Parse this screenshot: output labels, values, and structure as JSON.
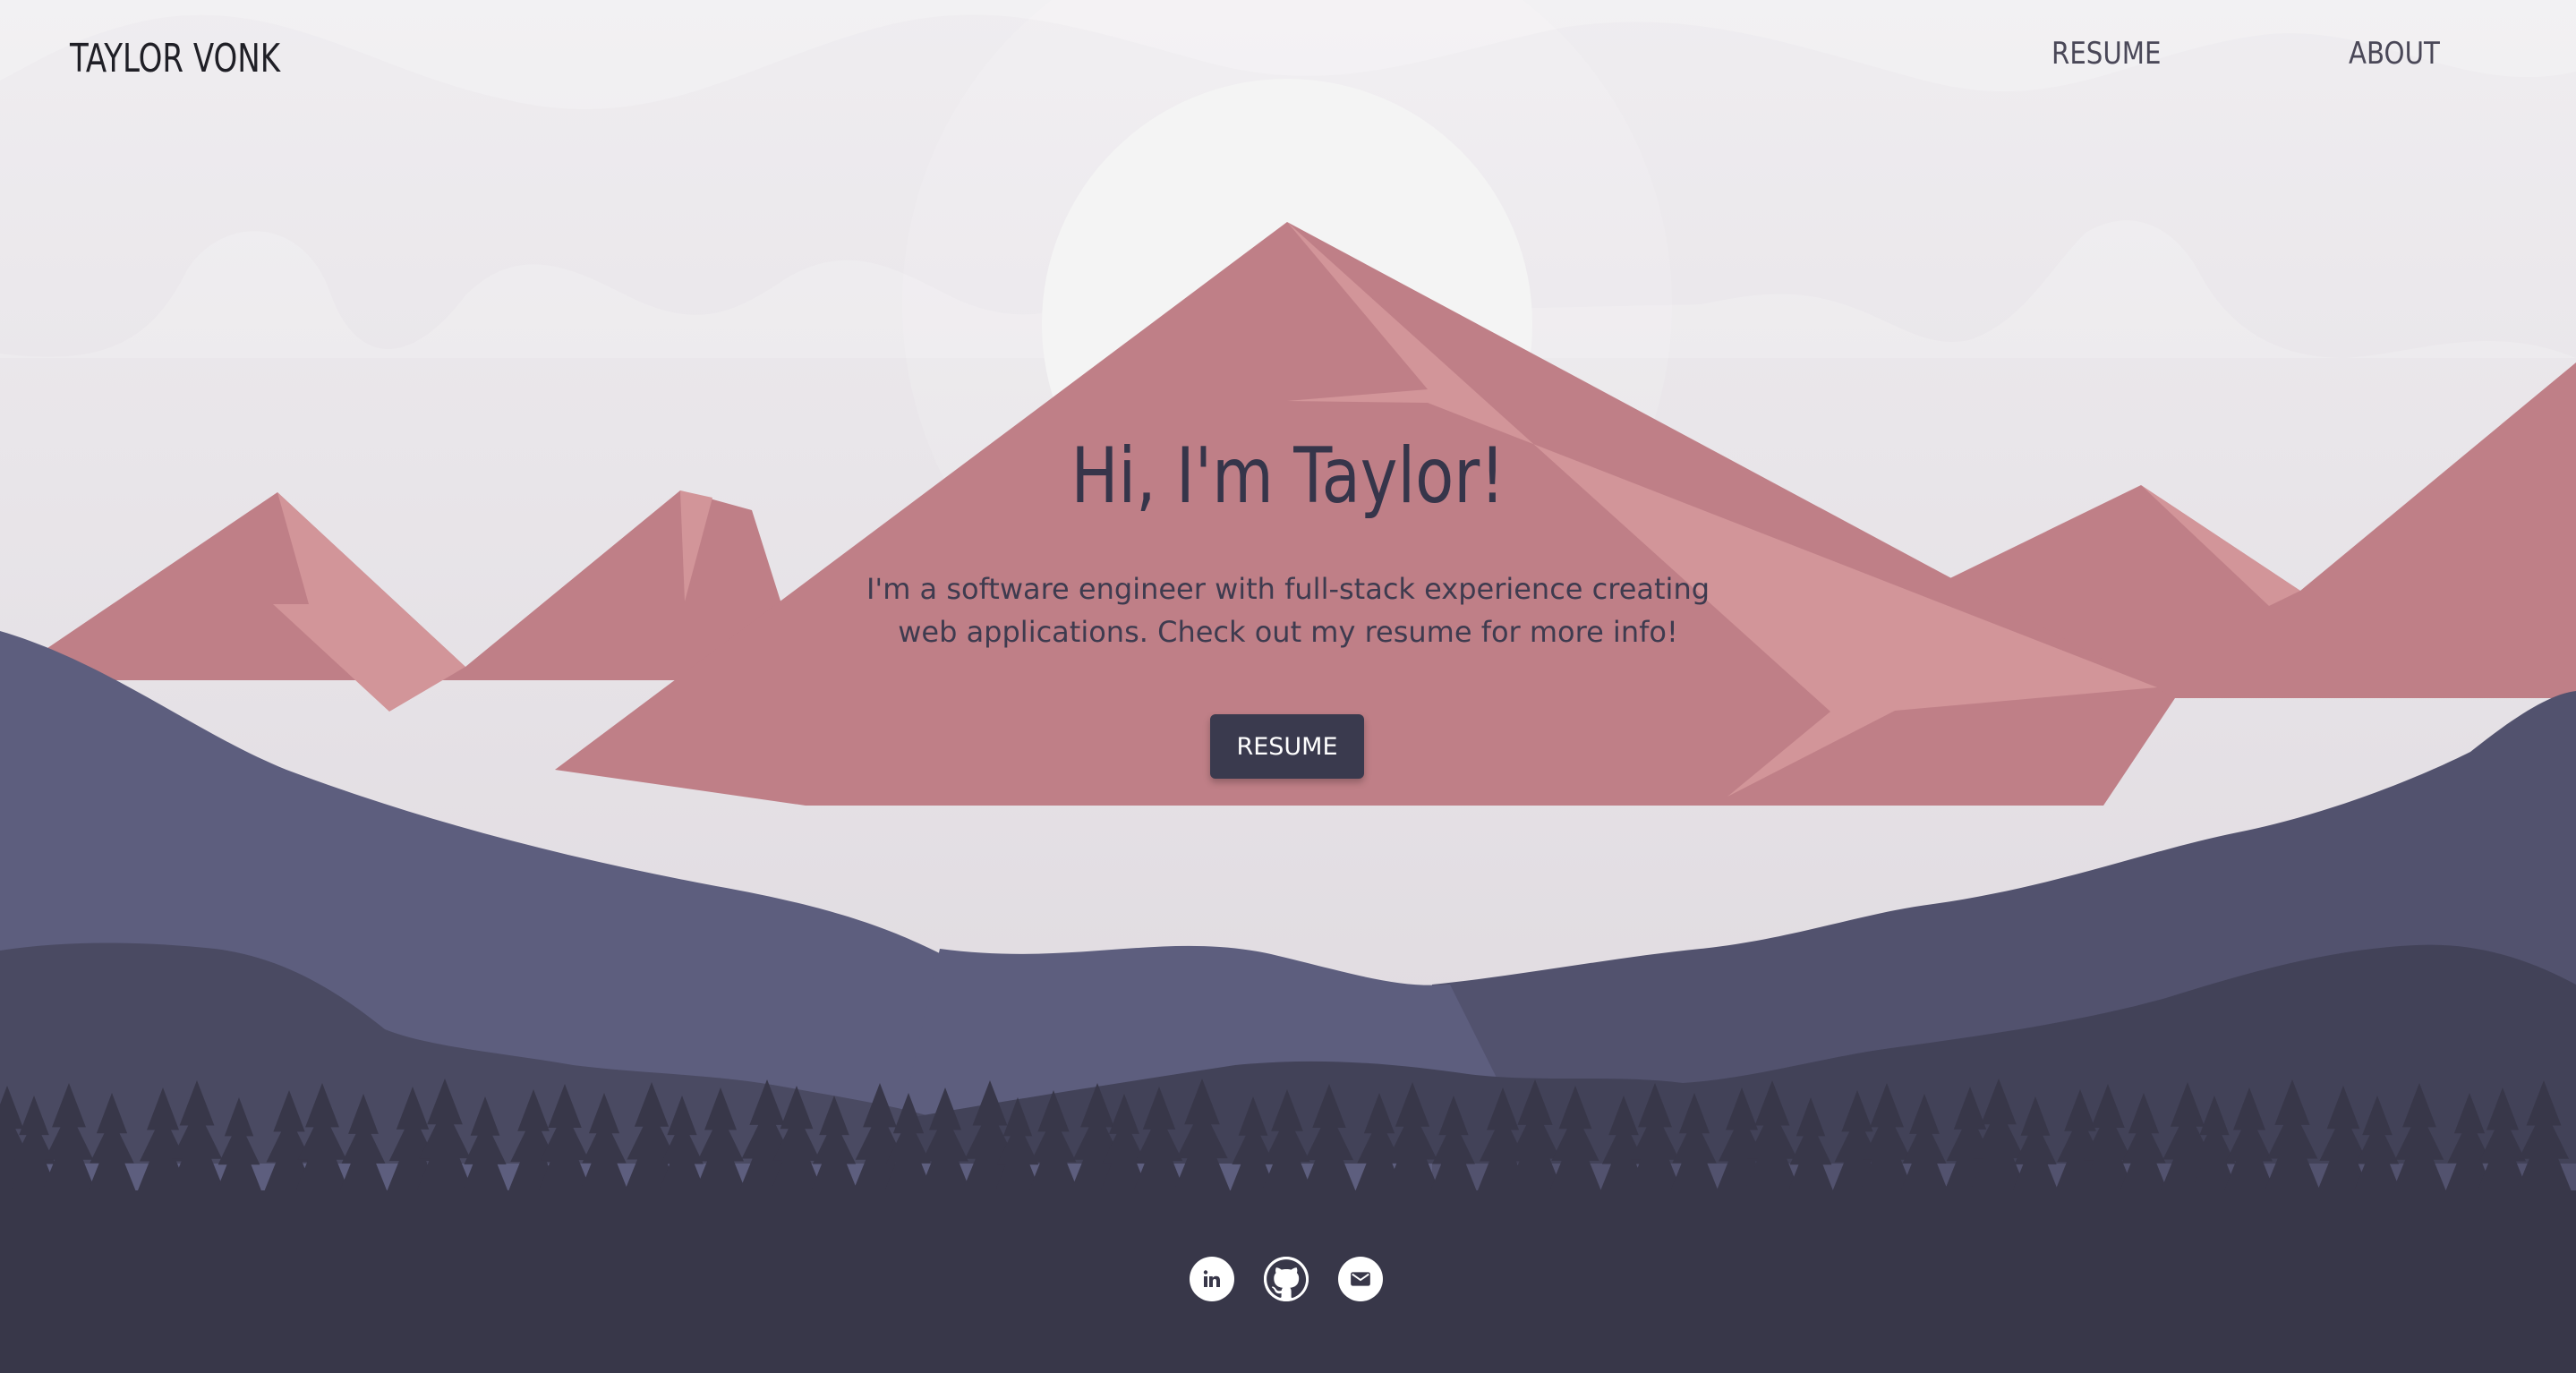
{
  "header": {
    "brand": "TAYLOR VONK",
    "nav": [
      {
        "label": "RESUME"
      },
      {
        "label": "ABOUT"
      }
    ]
  },
  "hero": {
    "title": "Hi, I'm Taylor!",
    "subtitle": "I'm a software engineer with full-stack experience creating web applications. Check out my resume for more info!",
    "cta_label": "RESUME"
  },
  "social": [
    {
      "icon": "linkedin-icon"
    },
    {
      "icon": "github-icon"
    },
    {
      "icon": "email-icon"
    }
  ],
  "colors": {
    "sky_top": "#efedf0",
    "sky_bottom": "#dcd6dc",
    "sun": "#f4f4f4",
    "mountain_shadow": "#bf7f87",
    "mountain_light": "#d29599",
    "hills_mid": "#5d5e7e",
    "hills_dark": "#4a4a62",
    "forest": "#383749",
    "button": "#3a3a4e"
  }
}
